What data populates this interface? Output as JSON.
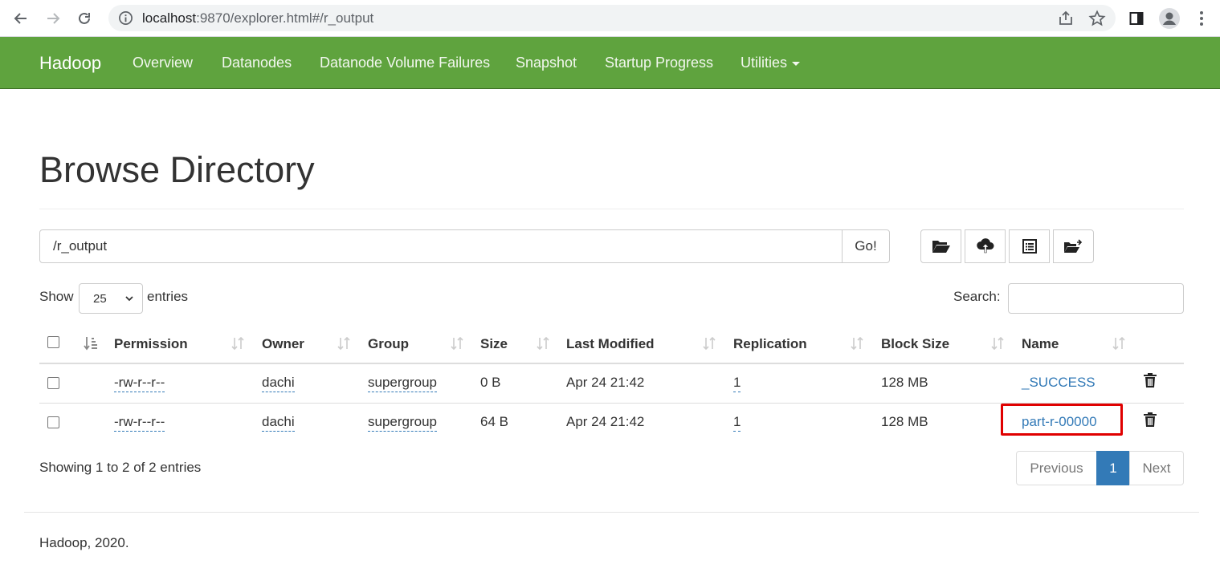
{
  "browser": {
    "url_host": "localhost",
    "url_rest": ":9870/explorer.html#/r_output"
  },
  "navbar": {
    "brand": "Hadoop",
    "links": [
      "Overview",
      "Datanodes",
      "Datanode Volume Failures",
      "Snapshot",
      "Startup Progress",
      "Utilities"
    ]
  },
  "page": {
    "title": "Browse Directory",
    "path_value": "/r_output",
    "go_label": "Go!",
    "show_label": "Show",
    "entries_label": "entries",
    "page_length": "25",
    "search_label": "Search:"
  },
  "table": {
    "headers": [
      "Permission",
      "Owner",
      "Group",
      "Size",
      "Last Modified",
      "Replication",
      "Block Size",
      "Name"
    ],
    "rows": [
      {
        "permission": "-rw-r--r--",
        "owner": "dachi",
        "group": "supergroup",
        "size": "0 B",
        "modified": "Apr 24 21:42",
        "replication": "1",
        "block_size": "128 MB",
        "name": "_SUCCESS"
      },
      {
        "permission": "-rw-r--r--",
        "owner": "dachi",
        "group": "supergroup",
        "size": "64 B",
        "modified": "Apr 24 21:42",
        "replication": "1",
        "block_size": "128 MB",
        "name": "part-r-00000"
      }
    ]
  },
  "pagination": {
    "info": "Showing 1 to 2 of 2 entries",
    "previous": "Previous",
    "current": "1",
    "next": "Next"
  },
  "footer": {
    "text": "Hadoop, 2020."
  },
  "colors": {
    "navbar": "#5fa33e",
    "link": "#337ab7",
    "highlight": "#e00000"
  }
}
